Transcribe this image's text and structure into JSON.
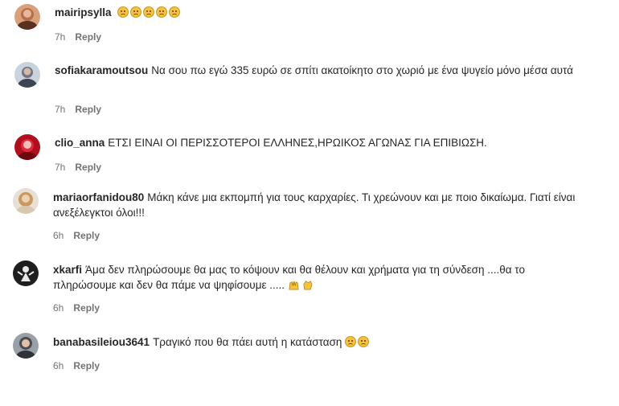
{
  "comments": [
    {
      "username": "mairipsylla",
      "text": "",
      "emojis": [
        "crying-face",
        "crying-face",
        "crying-face",
        "crying-face",
        "crying-face"
      ],
      "time": "7h",
      "reply": "Reply"
    },
    {
      "username": "sofiakaramoutsou",
      "text": "Να σου πω εγώ 335 ευρώ σε σπίτι ακατοίκητο στο χωριό με ένα ψυγείο μόνο μέσα αυτά",
      "time": "7h",
      "reply": "Reply"
    },
    {
      "username": "clio_anna",
      "text": "ΕΤΣΙ ΕΙΝΑΙ ΟΙ ΠΕΡΙΣΣΟΤΕΡΟΙ ΕΛΛΗΝΕΣ,ΗΡΩΙΚΟΣ ΑΓΩΝΑΣ ΓΙΑ ΕΠΙΒΙΩΣΗ.",
      "time": "7h",
      "reply": "Reply"
    },
    {
      "username": "mariaorfanidou80",
      "text": "Μάκη κάνε μια εκπομπή για τους καρχαρίες. Τι χρεώνουν και με ποιο δικαίωμα. Γιατί είναι ανεξέλεγκτοι όλοι!!!",
      "time": "6h",
      "reply": "Reply"
    },
    {
      "username": "xkarfi",
      "text": "Άμα δεν πληρώσουμε θα μας το κόψουν και θα θέλουν και χρήματα για τη σύνδεση ....θα το πληρώσουμε και δεν θα πάμε να ψηφίσουμε .....",
      "emojis": [
        "raising-hands",
        "clapping-hands"
      ],
      "time": "6h",
      "reply": "Reply"
    },
    {
      "username": "banabasileiou3641",
      "text": "Τραγικό που θα πάει αυτή η κατάσταση",
      "emojis": [
        "crying-face",
        "crying-face"
      ],
      "time": "6h",
      "reply": "Reply"
    }
  ]
}
